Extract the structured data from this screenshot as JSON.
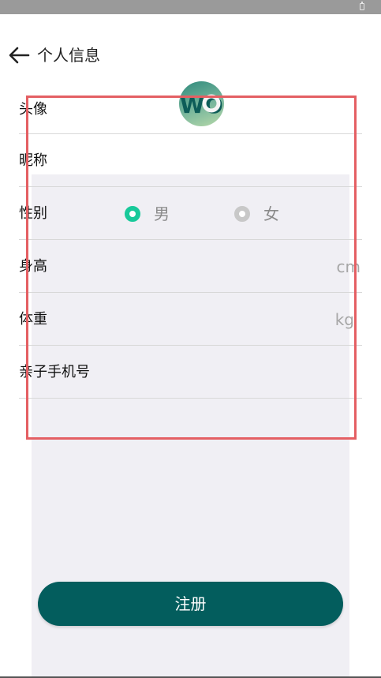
{
  "header": {
    "title": "个人信息",
    "back_icon": "arrow-left-icon"
  },
  "avatar": {
    "text": "WO"
  },
  "form": {
    "avatar_label": "头像",
    "nickname_label": "昵称",
    "gender_label": "性别",
    "gender_options": [
      {
        "label": "男",
        "selected": true
      },
      {
        "label": "女",
        "selected": false
      }
    ],
    "height_label": "身高",
    "height_unit": "cm",
    "weight_label": "体重",
    "weight_unit": "kg",
    "phone_label": "亲子手机号"
  },
  "actions": {
    "register_label": "注册"
  },
  "colors": {
    "accent": "#18c99a",
    "button": "#035d5d",
    "highlight": "#e45f63",
    "panel": "#f0eff4"
  }
}
